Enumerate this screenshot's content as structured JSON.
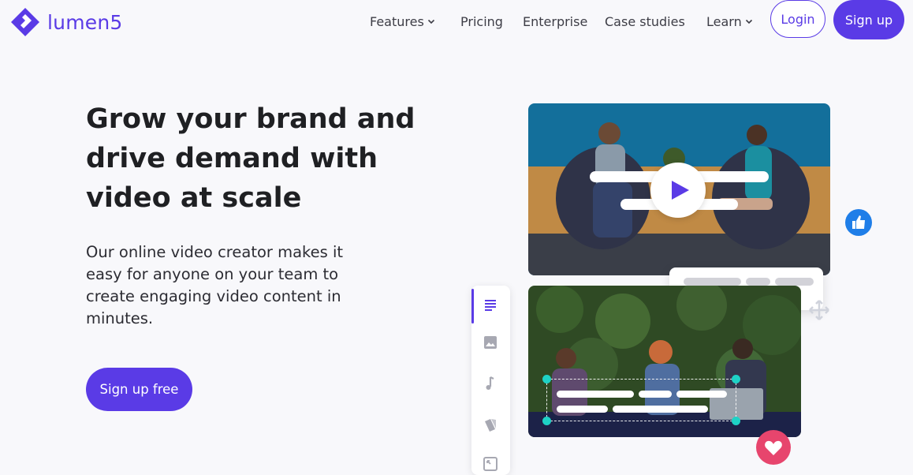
{
  "brand": {
    "name": "lumen5",
    "accent": "#5a3be6"
  },
  "nav": {
    "items": [
      {
        "label": "Features",
        "has_dropdown": true
      },
      {
        "label": "Pricing",
        "has_dropdown": false
      },
      {
        "label": "Enterprise",
        "has_dropdown": false
      },
      {
        "label": "Case studies",
        "has_dropdown": false
      },
      {
        "label": "Learn",
        "has_dropdown": true
      }
    ],
    "login_label": "Login",
    "signup_label": "Sign up"
  },
  "hero": {
    "headline": "Grow your brand and drive demand with video at scale",
    "subcopy": "Our online video creator makes it easy for anyone on your team to create engaging video content in minutes.",
    "cta_label": "Sign up free"
  },
  "media": {
    "top_video": "video-preview-meeting",
    "bottom_video": "video-preview-team",
    "editor_tools": [
      "text-icon",
      "image-icon",
      "music-icon",
      "style-icon",
      "resize-icon"
    ],
    "reactions": [
      "thumbs-up-icon",
      "heart-icon"
    ]
  },
  "colors": {
    "thumb": "#1f7ee8",
    "heart": "#e7456d",
    "selection_handle": "#1ed2c6"
  }
}
